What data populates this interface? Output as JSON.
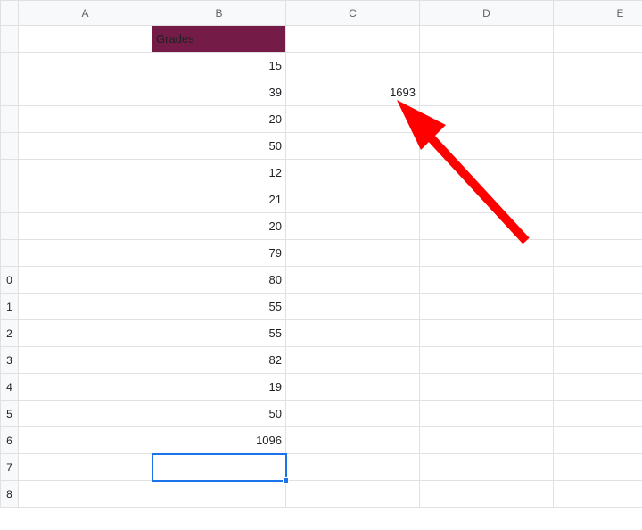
{
  "columns": [
    "A",
    "B",
    "C",
    "D",
    "E"
  ],
  "row_headers": [
    "",
    "",
    "",
    "",
    "",
    "",
    "",
    "",
    "",
    "0",
    "1",
    "2",
    "3",
    "4",
    "5",
    "6",
    "7",
    "8"
  ],
  "header_cell": {
    "text": "Grades",
    "bg": "#741b47"
  },
  "grades": [
    15,
    39,
    20,
    50,
    12,
    21,
    20,
    79,
    80,
    55,
    55,
    82,
    19,
    50,
    1096
  ],
  "c_value": 1693,
  "selected_cell": {
    "row": 17,
    "col": "B"
  },
  "annotation": {
    "type": "arrow",
    "color": "#ff0000"
  }
}
